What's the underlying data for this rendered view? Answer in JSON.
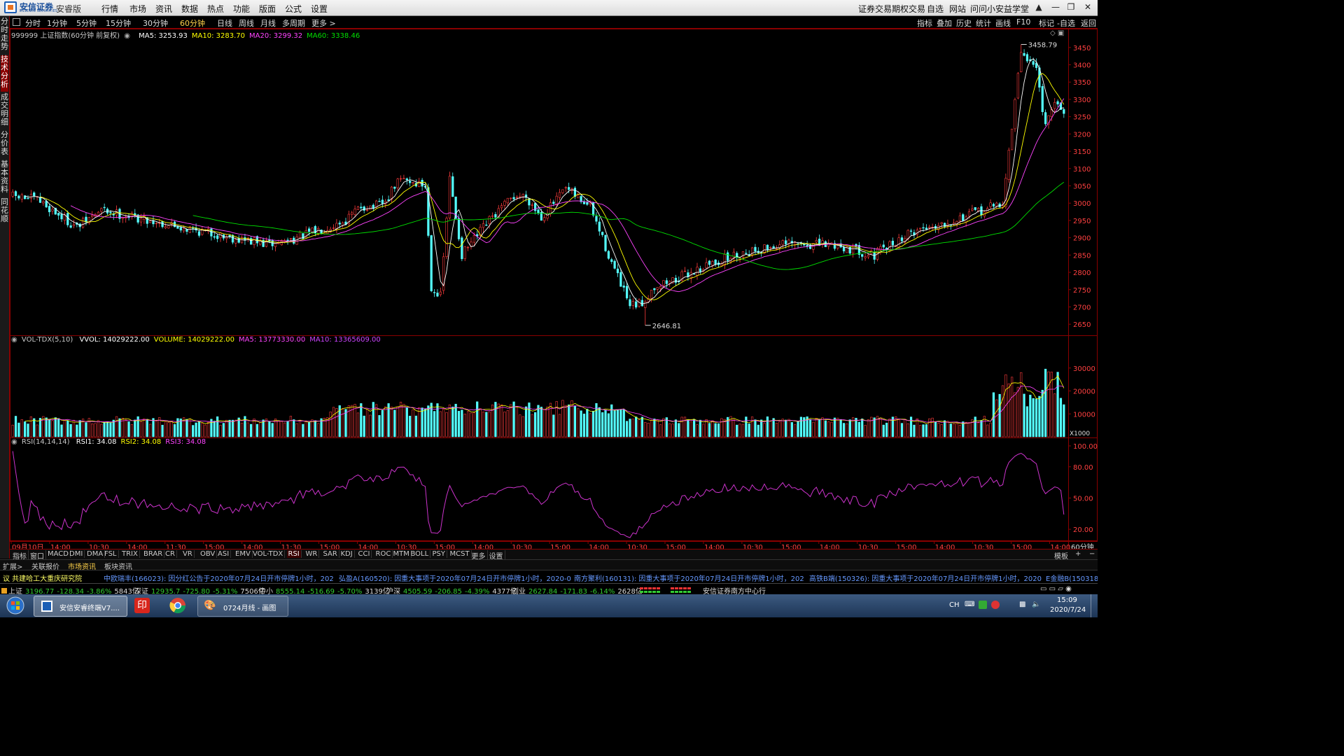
{
  "app": {
    "brand": "安信证券",
    "brand_sub": "ESSENCE SECURITIES",
    "edition": "安睿版",
    "menu": [
      "行情",
      "市场",
      "资讯",
      "数据",
      "热点",
      "功能",
      "版面",
      "公式",
      "设置"
    ],
    "right_menu": [
      "证券交易",
      "期权交易",
      "自选",
      "网站",
      "问问小安",
      "益学堂"
    ]
  },
  "left_tabs": [
    {
      "label": "分时走势",
      "active": false
    },
    {
      "label": "技术分析",
      "active": true
    },
    {
      "label": "成交明细",
      "active": false
    },
    {
      "label": "分价表",
      "active": false
    },
    {
      "label": "基本资料",
      "active": false
    },
    {
      "label": "同花顺",
      "active": false
    }
  ],
  "period_tabs": [
    {
      "label": "分时",
      "active": false
    },
    {
      "label": "1分钟",
      "active": false
    },
    {
      "label": "5分钟",
      "active": false
    },
    {
      "label": "15分钟",
      "active": false
    },
    {
      "label": "30分钟",
      "active": false
    },
    {
      "label": "60分钟",
      "active": true
    },
    {
      "label": "日线",
      "active": false
    },
    {
      "label": "周线",
      "active": false
    },
    {
      "label": "月线",
      "active": false
    },
    {
      "label": "多周期",
      "active": false
    },
    {
      "label": "更多 >",
      "active": false
    }
  ],
  "right_tools": [
    "指标",
    "叠加",
    "历史",
    "统计",
    "画线",
    "F10",
    "标记",
    "-自选",
    "返回"
  ],
  "main_chart": {
    "title": "999999 上证指数(60分钟 前复权)",
    "ma": [
      {
        "label": "MA5: 3253.93",
        "color": "#ffffff"
      },
      {
        "label": "MA10: 3283.70",
        "color": "#ffff00"
      },
      {
        "label": "MA20: 3299.32",
        "color": "#ff44ff"
      },
      {
        "label": "MA60: 3338.46",
        "color": "#00e000"
      }
    ],
    "high_label": "3458.79",
    "low_label": "2646.81",
    "y_ticks": [
      "3450",
      "3400",
      "3350",
      "3300",
      "3250",
      "3200",
      "3150",
      "3100",
      "3050",
      "3000",
      "2950",
      "2900",
      "2850",
      "2800",
      "2750",
      "2700",
      "2650"
    ]
  },
  "volume_chart": {
    "title": "VOL-TDX(5,10)",
    "items": [
      {
        "label": "VVOL: 14029222.00",
        "color": "#ffffff"
      },
      {
        "label": "VOLUME: 14029222.00",
        "color": "#ffff00"
      },
      {
        "label": "MA5: 13773330.00",
        "color": "#ff44ff"
      },
      {
        "label": "MA10: 13365609.00",
        "color": "#cc44ff"
      }
    ],
    "y_ticks": [
      "30000",
      "20000",
      "10000"
    ],
    "unit": "X1000"
  },
  "rsi_chart": {
    "title": "RSI(14,14,14)",
    "items": [
      {
        "label": "RSI1: 34.08",
        "color": "#ffffff"
      },
      {
        "label": "RSI2: 34.08",
        "color": "#ffff00"
      },
      {
        "label": "RSI3: 34.08",
        "color": "#ff44ff"
      }
    ],
    "y_ticks": [
      "100.00",
      "80.00",
      "50.00",
      "20.00"
    ]
  },
  "time_axis": [
    "09月10日",
    "14:00",
    "10:30",
    "14:00",
    "11:30",
    "15:00",
    "14:00",
    "11:30",
    "15:00",
    "14:00",
    "10:30",
    "15:00",
    "14:00",
    "10:30",
    "15:00",
    "14:00",
    "10:30",
    "15:00",
    "14:00",
    "10:30",
    "15:00",
    "14:00",
    "10:30",
    "15:00",
    "14:00",
    "10:30",
    "15:00",
    "14:00"
  ],
  "period_label": "60分钟",
  "indicator_tabs": [
    "指标",
    "窗口",
    "MACD",
    "DMI",
    "DMA",
    "FSL",
    "TRIX",
    "BRAR",
    "CR",
    "VR",
    "OBV",
    "ASI",
    "EMV",
    "VOL-TDX",
    "RSI",
    "WR",
    "SAR",
    "KDJ",
    "CCI",
    "ROC",
    "MTM",
    "BOLL",
    "PSY",
    "MCST",
    "更多",
    "设置"
  ],
  "active_indicator": "RSI",
  "indicator_right": "模板",
  "ext_tabs": [
    {
      "label": "扩展>",
      "active": false
    },
    {
      "label": "关联报价",
      "active": false
    },
    {
      "label": "市场资讯",
      "active": true
    },
    {
      "label": "板块资讯",
      "active": false
    }
  ],
  "news": [
    {
      "code": "议 共建哈工大重庆研究院",
      "color": "#ffff66"
    },
    {
      "code": "中欧瑞丰(166023):",
      "text": "因分红公告于2020年07月24日开市停牌1小时，202",
      "color": "#6699ff"
    },
    {
      "code": "弘盈A(160520):",
      "text": "因重大事项于2020年07月24日开市停牌1小时，2020-0",
      "color": "#6699ff"
    },
    {
      "code": "南方聚利(160131):",
      "text": "因重大事项于2020年07月24日开市停牌1小时，202",
      "color": "#6699ff"
    },
    {
      "code": "高铁B端(150326):",
      "text": "因重大事项于2020年07月24日开市停牌1小时，2020",
      "color": "#6699ff"
    },
    {
      "code": "E金融B(150318):",
      "text": "",
      "color": "#6699ff"
    }
  ],
  "indices": [
    {
      "name": "上证",
      "value": "3196.77",
      "change": "-128.34",
      "pct": "-3.86%",
      "amount": "5843亿"
    },
    {
      "name": "深证",
      "value": "12935.7",
      "change": "-725.80",
      "pct": "-5.31%",
      "amount": "7506亿"
    },
    {
      "name": "中小",
      "value": "8555.14",
      "change": "-516.69",
      "pct": "-5.70%",
      "amount": "3139亿"
    },
    {
      "name": "沪深",
      "value": "4505.59",
      "change": "-206.85",
      "pct": "-4.39%",
      "amount": "4377亿"
    },
    {
      "name": "创业",
      "value": "2627.84",
      "change": "-171.83",
      "pct": "-6.14%",
      "amount": "2628亿"
    }
  ],
  "branch": "安信证券南方中心行",
  "taskbar": {
    "items": [
      {
        "label": "安信安睿终端V7....",
        "active": true
      },
      {
        "label": "0724月线 - 画图",
        "active": false
      }
    ],
    "tray_lang": "CH",
    "time": "15:09",
    "date": "2020/7/24"
  },
  "chart_data": {
    "type": "candlestick",
    "symbol": "999999 上证指数",
    "ylim": [
      2620,
      3480
    ],
    "n_bars": 345,
    "anchors": [
      [
        0,
        3020
      ],
      [
        10,
        3010
      ],
      [
        25,
        2930
      ],
      [
        35,
        2980
      ],
      [
        60,
        2940
      ],
      [
        85,
        2900
      ],
      [
        100,
        2880
      ],
      [
        110,
        2900
      ],
      [
        135,
        2990
      ],
      [
        150,
        3060
      ],
      [
        160,
        3080
      ],
      [
        170,
        3070
      ],
      [
        145,
        3000
      ],
      [
        130,
        2950
      ],
      [
        140,
        2990
      ],
      [
        148,
        3050
      ],
      [
        152,
        3070
      ],
      [
        156,
        3060
      ],
      [
        160,
        3050
      ],
      [
        163,
        2760
      ],
      [
        166,
        2730
      ],
      [
        175,
        2850
      ],
      [
        185,
        2950
      ],
      [
        195,
        3020
      ],
      [
        200,
        3020
      ],
      [
        205,
        2960
      ],
      [
        215,
        3040
      ],
      [
        225,
        2990
      ],
      [
        232,
        2850
      ],
      [
        240,
        2700
      ],
      [
        245,
        2710
      ],
      [
        250,
        2760
      ],
      [
        258,
        2780
      ],
      [
        270,
        2820
      ],
      [
        285,
        2860
      ],
      [
        300,
        2880
      ],
      [
        320,
        2880
      ],
      [
        335,
        2850
      ],
      [
        350,
        2920
      ],
      [
        370,
        2960
      ],
      [
        385,
        3000
      ],
      [
        392,
        3440
      ],
      [
        398,
        3390
      ],
      [
        402,
        3220
      ],
      [
        406,
        3300
      ],
      [
        410,
        3220
      ]
    ],
    "extremes": {
      "high": 3458.79,
      "low": 2646.81
    },
    "last_ma": {
      "ma5": 3253.93,
      "ma10": 3283.7,
      "ma20": 3299.32,
      "ma60": 3338.46
    },
    "volume_last": 14029222.0,
    "volume_ma5": 13773330.0,
    "volume_ma10": 13365609.0,
    "rsi_last": 34.08
  }
}
